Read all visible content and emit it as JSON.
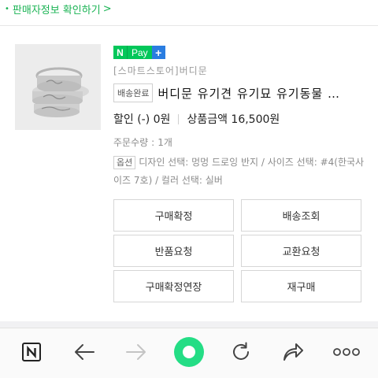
{
  "top_link": {
    "text": "판매자정보 확인하기"
  },
  "pay_badge": {
    "n": "N",
    "pay": "Pay",
    "plus": "+"
  },
  "order": {
    "store": "[스마트스토어]버디문",
    "status_tag": "배송완료",
    "title": "버디문 유기견 유기묘 유기동물 …",
    "discount": "할인 (-) 0원",
    "amount": "상품금액 16,500원",
    "qty_label": "주문수량",
    "qty_value": "1개",
    "option_tag": "옵션",
    "option_text": "디자인 선택: 멍멍 드로잉 반지 / 사이즈 선택: #4(한국사이즈 7호) / 컬러 선택: 실버"
  },
  "buttons": {
    "confirm": "구매확정",
    "track": "배송조회",
    "return": "반품요청",
    "exchange": "교환요청",
    "extend": "구매확정연장",
    "rebuy": "재구매"
  },
  "colors": {
    "naver_green": "#03c75a",
    "link_green": "#19b353",
    "pay_plus_blue": "#2a7de1"
  },
  "nav_icons": [
    "naver-n-icon",
    "back-arrow-icon",
    "forward-arrow-icon",
    "home-circle-icon",
    "reload-icon",
    "share-icon",
    "more-icon"
  ]
}
